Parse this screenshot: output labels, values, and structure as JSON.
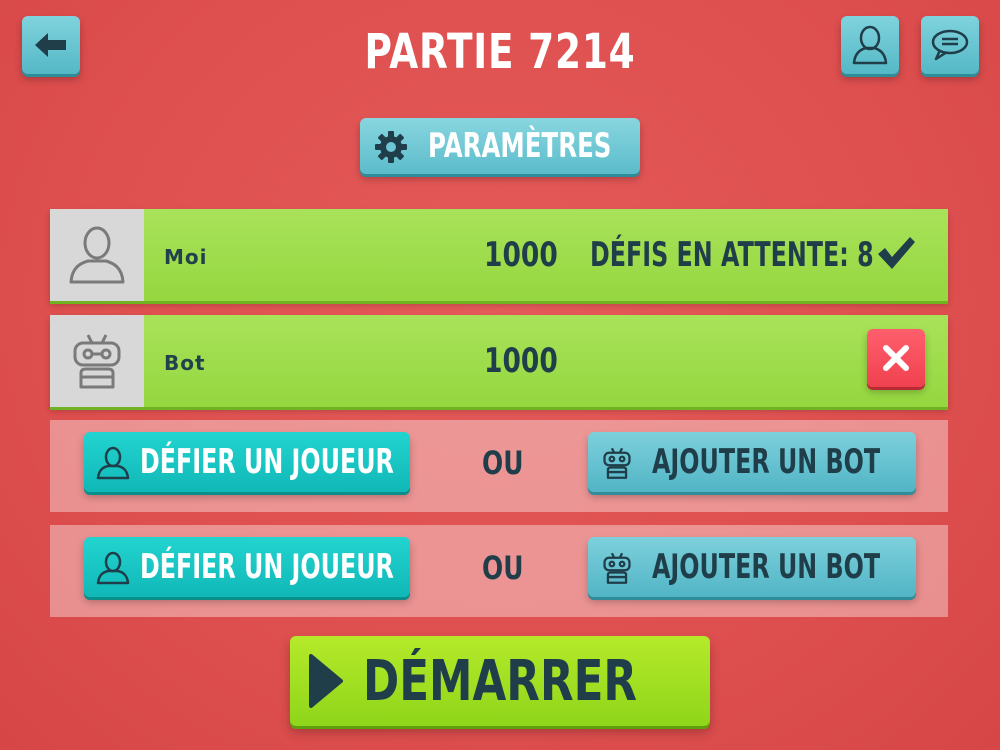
{
  "header": {
    "title": "PARTIE 7214",
    "back_icon": "arrow-left-icon",
    "profile_icon": "user-icon",
    "chat_icon": "chat-bubble-icon"
  },
  "settings": {
    "label": "PARAMÈTRES",
    "icon": "gear-icon"
  },
  "players": [
    {
      "name": "Moi",
      "score": "1000",
      "status": "DÉFIS EN ATTENTE: 8",
      "avatar_icon": "user-icon",
      "action_icon": "check-icon"
    },
    {
      "name": "Bot",
      "score": "1000",
      "status": "",
      "avatar_icon": "robot-icon",
      "action_icon": "close-icon"
    }
  ],
  "slots": [
    {
      "challenge_label": "DÉFIER UN JOUEUR",
      "or_label": "OU",
      "bot_label": "AJOUTER UN BOT"
    },
    {
      "challenge_label": "DÉFIER UN JOUEUR",
      "or_label": "OU",
      "bot_label": "AJOUTER UN BOT"
    }
  ],
  "start": {
    "label": "DÉMARRER",
    "icon": "play-icon"
  },
  "colors": {
    "background": "#de4f4f",
    "player_row": "#9ddc4a",
    "teal_button": "#18c6c3",
    "light_blue_button": "#66c3d1",
    "remove_button": "#f54b59",
    "start_button": "#a3e022",
    "dark_text": "#1f3e4a"
  }
}
